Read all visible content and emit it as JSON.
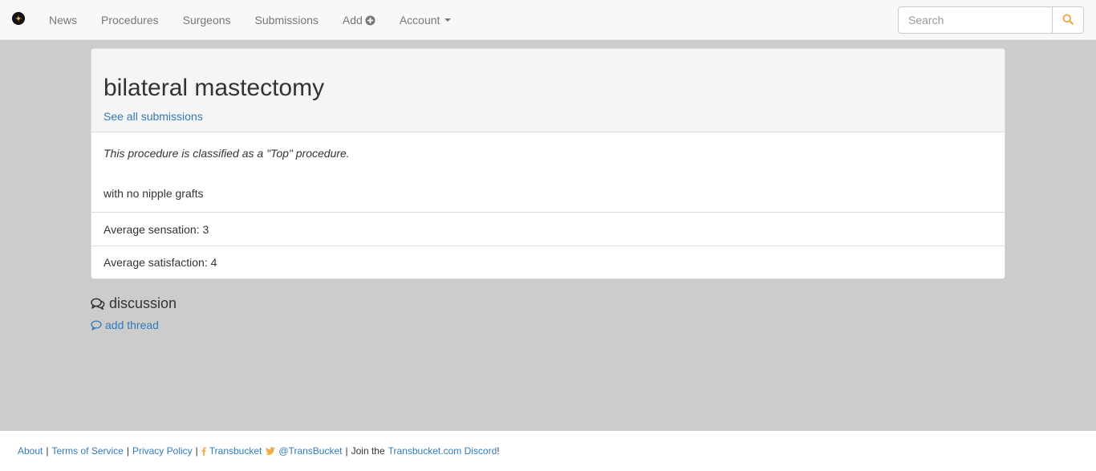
{
  "navbar": {
    "logo_icon": "transbucket-logo",
    "items": [
      {
        "label": "News"
      },
      {
        "label": "Procedures"
      },
      {
        "label": "Surgeons"
      },
      {
        "label": "Submissions"
      },
      {
        "label": "Add",
        "icon": "plus-circle-icon"
      },
      {
        "label": "Account",
        "icon": "caret-down-icon"
      }
    ],
    "search": {
      "placeholder": "Search",
      "value": ""
    },
    "search_icon": "search-icon",
    "accent_color": "#f0ad4e"
  },
  "procedure": {
    "title": "bilateral mastectomy",
    "see_all_link": "See all submissions",
    "classification": "This procedure is classified as a \"Top\" procedure.",
    "note": "with no nipple grafts",
    "avg_sensation": "Average sensation: 3",
    "avg_satisfaction": "Average satisfaction: 4"
  },
  "discussion": {
    "icon": "comments-icon",
    "heading": "discussion",
    "add_thread_icon": "comment-icon",
    "add_thread": "add thread"
  },
  "footer": {
    "about": "About",
    "terms": "Terms of Service",
    "privacy": "Privacy Policy",
    "facebook_icon": "facebook-icon",
    "facebook": "Transbucket",
    "twitter_icon": "twitter-icon",
    "twitter": "@TransBucket",
    "join_prefix": "Join the",
    "discord": "Transbucket.com Discord",
    "join_suffix": "!",
    "separator": "|"
  }
}
